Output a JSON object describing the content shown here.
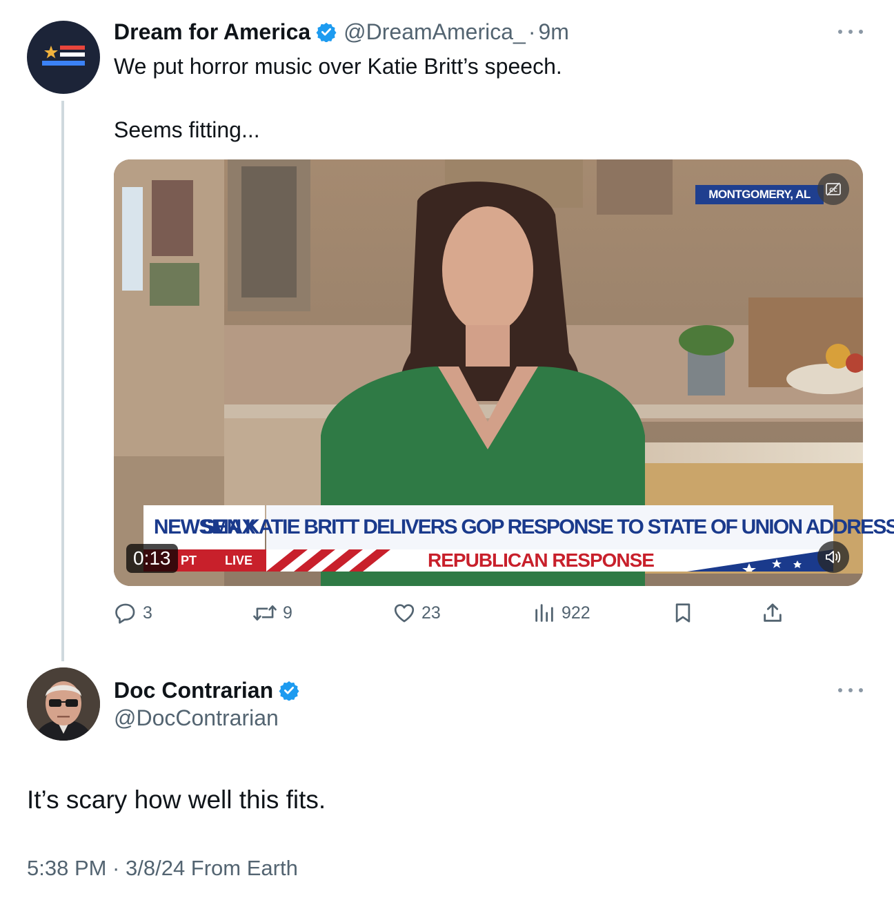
{
  "colors": {
    "accent": "#1d9bf0",
    "text_primary": "#0f1419",
    "text_secondary": "#536471",
    "newsmax_blue": "#1a3a8c",
    "newsmax_red": "#c8202b"
  },
  "original_tweet": {
    "author_name": "Dream for America",
    "verified_icon": "verified-badge-icon",
    "handle": "@DreamAmerica_",
    "separator": "·",
    "time": "9m",
    "more_icon": "more-options-icon",
    "text_line_1": "We put horror music over Katie Britt’s speech.",
    "text_line_2": "Seems fitting...",
    "media": {
      "type": "video",
      "location_tag": "MONTGOMERY, AL",
      "captions_icon": "closed-captions-icon",
      "chyron_logo": "NEWSMAX",
      "chyron_headline": "SEN KATIE BRITT DELIVERS GOP RESPONSE TO STATE OF UNION ADDRESS",
      "chyron_time": "PT",
      "chyron_live": "LIVE",
      "chyron_subtitle": "REPUBLICAN RESPONSE",
      "elapsed": "0:13",
      "mute_icon": "speaker-muted-icon"
    },
    "actions": {
      "replies": "3",
      "reposts": "9",
      "likes": "23",
      "views": "922"
    }
  },
  "reply_tweet": {
    "author_name": "Doc Contrarian",
    "verified_icon": "verified-badge-icon",
    "handle": "@DocContrarian",
    "more_icon": "more-options-icon",
    "text": "It’s scary how well this fits.",
    "timestamp": "5:38 PM · 3/8/24 From Earth"
  }
}
